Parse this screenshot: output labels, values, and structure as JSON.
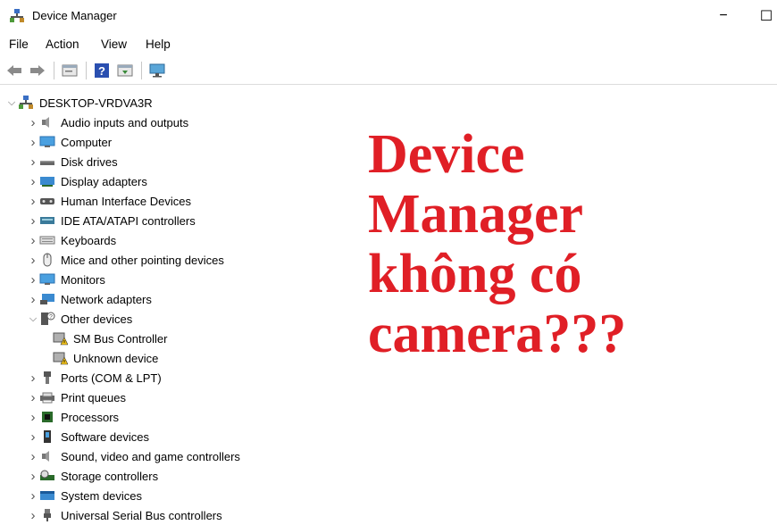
{
  "window": {
    "title": "Device Manager",
    "minimize_glyph": "−",
    "maximize_glyph": "☐"
  },
  "menu": [
    "File",
    "Action",
    "View",
    "Help"
  ],
  "toolbar_icons": [
    "back-arrow-icon",
    "forward-arrow-icon",
    "properties-icon",
    "help-icon",
    "update-driver-icon",
    "monitor-icon"
  ],
  "tree": {
    "root": "DESKTOP-VRDVA3R",
    "items": [
      {
        "label": "Audio inputs and outputs",
        "icon": "speaker-icon",
        "expanded": false
      },
      {
        "label": "Computer",
        "icon": "computer-icon",
        "expanded": false
      },
      {
        "label": "Disk drives",
        "icon": "disk-drive-icon",
        "expanded": false
      },
      {
        "label": "Display adapters",
        "icon": "display-adapter-icon",
        "expanded": false
      },
      {
        "label": "Human Interface Devices",
        "icon": "hid-icon",
        "expanded": false
      },
      {
        "label": "IDE ATA/ATAPI controllers",
        "icon": "ide-controller-icon",
        "expanded": false
      },
      {
        "label": "Keyboards",
        "icon": "keyboard-icon",
        "expanded": false
      },
      {
        "label": "Mice and other pointing devices",
        "icon": "mouse-icon",
        "expanded": false
      },
      {
        "label": "Monitors",
        "icon": "monitor-icon",
        "expanded": false
      },
      {
        "label": "Network adapters",
        "icon": "network-adapter-icon",
        "expanded": false
      },
      {
        "label": "Other devices",
        "icon": "unknown-device-icon",
        "expanded": true
      },
      {
        "label": "SM Bus Controller",
        "icon": "warning-device-icon",
        "child": true
      },
      {
        "label": "Unknown device",
        "icon": "warning-device-icon",
        "child": true
      },
      {
        "label": "Ports (COM & LPT)",
        "icon": "port-icon",
        "expanded": false
      },
      {
        "label": "Print queues",
        "icon": "printer-icon",
        "expanded": false
      },
      {
        "label": "Processors",
        "icon": "processor-icon",
        "expanded": false
      },
      {
        "label": "Software devices",
        "icon": "software-device-icon",
        "expanded": false
      },
      {
        "label": "Sound, video and game controllers",
        "icon": "speaker-icon",
        "expanded": false
      },
      {
        "label": "Storage controllers",
        "icon": "storage-controller-icon",
        "expanded": false
      },
      {
        "label": "System devices",
        "icon": "system-device-icon",
        "expanded": false
      },
      {
        "label": "Universal Serial Bus controllers",
        "icon": "usb-icon",
        "expanded": false
      }
    ]
  },
  "overlay": {
    "lines": [
      "Device",
      "Manager",
      "không có",
      "camera???"
    ],
    "color": "#e01f26"
  }
}
